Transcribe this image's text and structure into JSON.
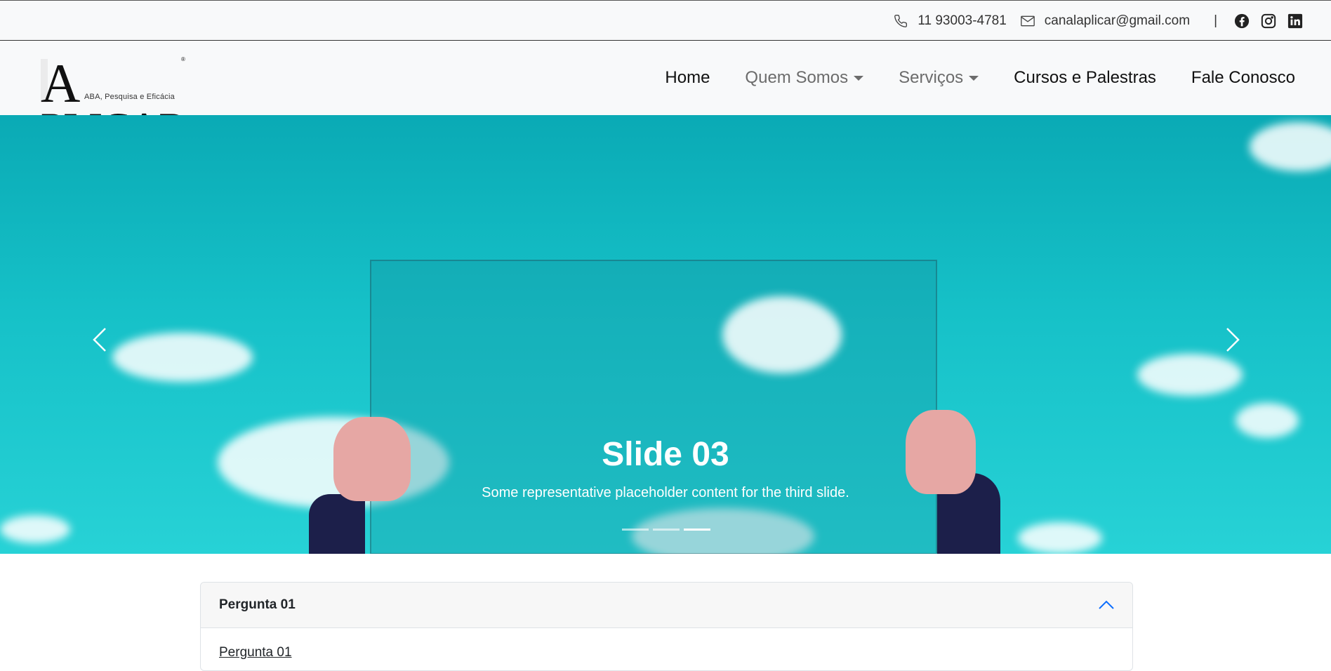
{
  "topbar": {
    "phone": "11 93003-4781",
    "email": "canalaplicar@gmail.com",
    "separator": "|",
    "icons": [
      "phone-icon",
      "envelope-icon",
      "facebook-icon",
      "instagram-icon",
      "linkedin-icon"
    ]
  },
  "brand": {
    "name_first": "A",
    "name_rest": "PLICAR",
    "registered": "®",
    "tagline": "ABA, Pesquisa e Eficácia"
  },
  "nav": {
    "home": "Home",
    "quem_somos": "Quem Somos",
    "servicos": "Serviços",
    "cursos": "Cursos e Palestras",
    "fale": "Fale Conosco"
  },
  "carousel": {
    "title": "Slide 03",
    "text": "Some representative placeholder content for the third slide.",
    "slide_count": 3,
    "active_index": 2
  },
  "accordion": {
    "header": "Pergunta 01",
    "body_link": "Pergunta 01",
    "expanded": true
  },
  "colors": {
    "sky": "#16c1c8",
    "nav_muted": "#6c6c6c",
    "accordion_chevron": "#0d6efd"
  }
}
